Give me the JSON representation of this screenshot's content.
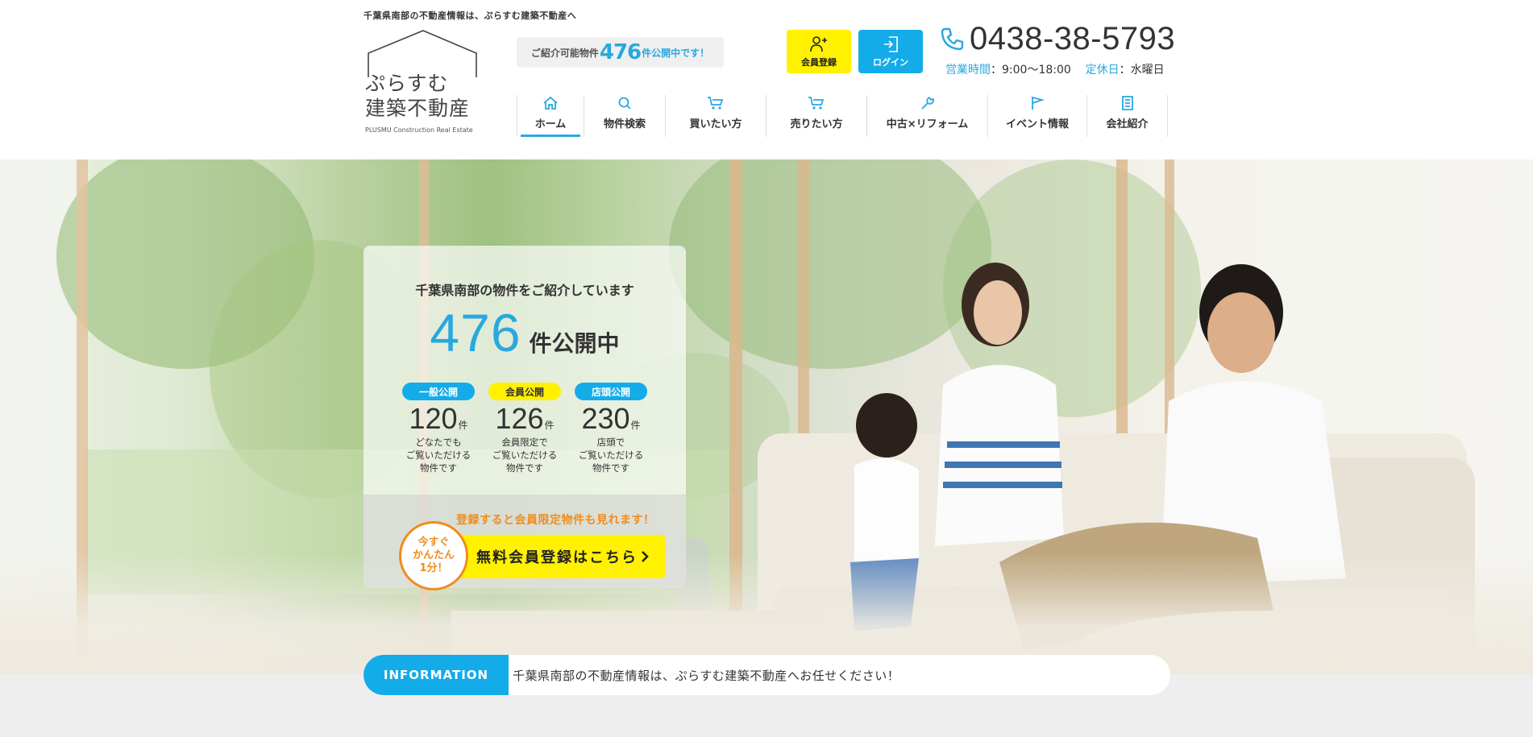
{
  "header": {
    "tagline": "千葉県南部の不動産情報は、ぷらすむ建築不動産へ",
    "logo": {
      "line1": "ぷらすむ",
      "line2": "建築不動産",
      "sub": "PLUSMU Construction Real Estate"
    },
    "count_pill": {
      "prefix": "ご紹介可能物件",
      "number": "476",
      "suffix": "件公開中です！"
    },
    "buttons": {
      "register": "会員登録",
      "login": "ログイン"
    },
    "phone": {
      "icon": "phone-icon",
      "number": "0438-38-5793"
    },
    "hours": {
      "label": "営業時間",
      "value": "：9:00〜18:00",
      "closed_label": "定休日",
      "closed_value": "：水曜日"
    },
    "nav": [
      {
        "label": "ホーム",
        "icon": "home-icon",
        "active": true
      },
      {
        "label": "物件検索",
        "icon": "search-icon"
      },
      {
        "label": "買いたい方",
        "icon": "cart-icon"
      },
      {
        "label": "売りたい方",
        "icon": "cart-icon"
      },
      {
        "label": "中古×リフォーム",
        "icon": "wrench-icon"
      },
      {
        "label": "イベント情報",
        "icon": "flag-icon"
      },
      {
        "label": "会社紹介",
        "icon": "building-icon"
      }
    ]
  },
  "hero": {
    "headline": "千葉県南部の物件をご紹介しています",
    "total_number": "476",
    "total_unit": "件公開中",
    "stats": [
      {
        "badge": "一般公開",
        "number": "120",
        "unit": "件",
        "desc": "どなたでも\nご覧いただける\n物件です",
        "color": "#14abe9"
      },
      {
        "badge": "会員公開",
        "number": "126",
        "unit": "件",
        "desc": "会員限定で\nご覧いただける\n物件です",
        "color": "#fff100"
      },
      {
        "badge": "店頭公開",
        "number": "230",
        "unit": "件",
        "desc": "店頭で\nご覧いただける\n物件です",
        "color": "#14abe9"
      }
    ],
    "promo": "登録すると会員限定物件も見れます！",
    "cta": "無料会員登録はこちら",
    "circle": "今すぐ\nかんたん\n1分！"
  },
  "info": {
    "label": "INFORMATION",
    "text": "千葉県南部の不動産情報は、ぷらすむ建築不動産へお任せください！"
  },
  "colors": {
    "accent_blue": "#14abe9",
    "accent_yellow": "#fff100",
    "accent_orange": "#f08c1e"
  }
}
